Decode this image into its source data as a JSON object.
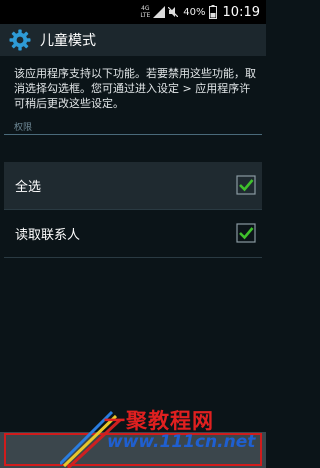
{
  "status_bar": {
    "network_top": "4G",
    "network_bottom": "LTE",
    "battery_percent": "40%",
    "time": "10:19"
  },
  "app_bar": {
    "title": "儿童模式",
    "icon": "gear-icon"
  },
  "description": "该应用程序支持以下功能。若要禁用这些功能，取消选择勾选框。您可通过进入设定 > 应用程序许可稍后更改这些设定。",
  "section_header": "权限",
  "permissions": [
    {
      "label": "全选",
      "checked": true
    },
    {
      "label": "读取联系人",
      "checked": true
    }
  ],
  "watermark": {
    "title": "一聚教程网",
    "url": "www.111cn.net"
  },
  "colors": {
    "accent": "#2e9bd6",
    "check": "#3fc12c",
    "highlight_border": "#d01c1c"
  }
}
